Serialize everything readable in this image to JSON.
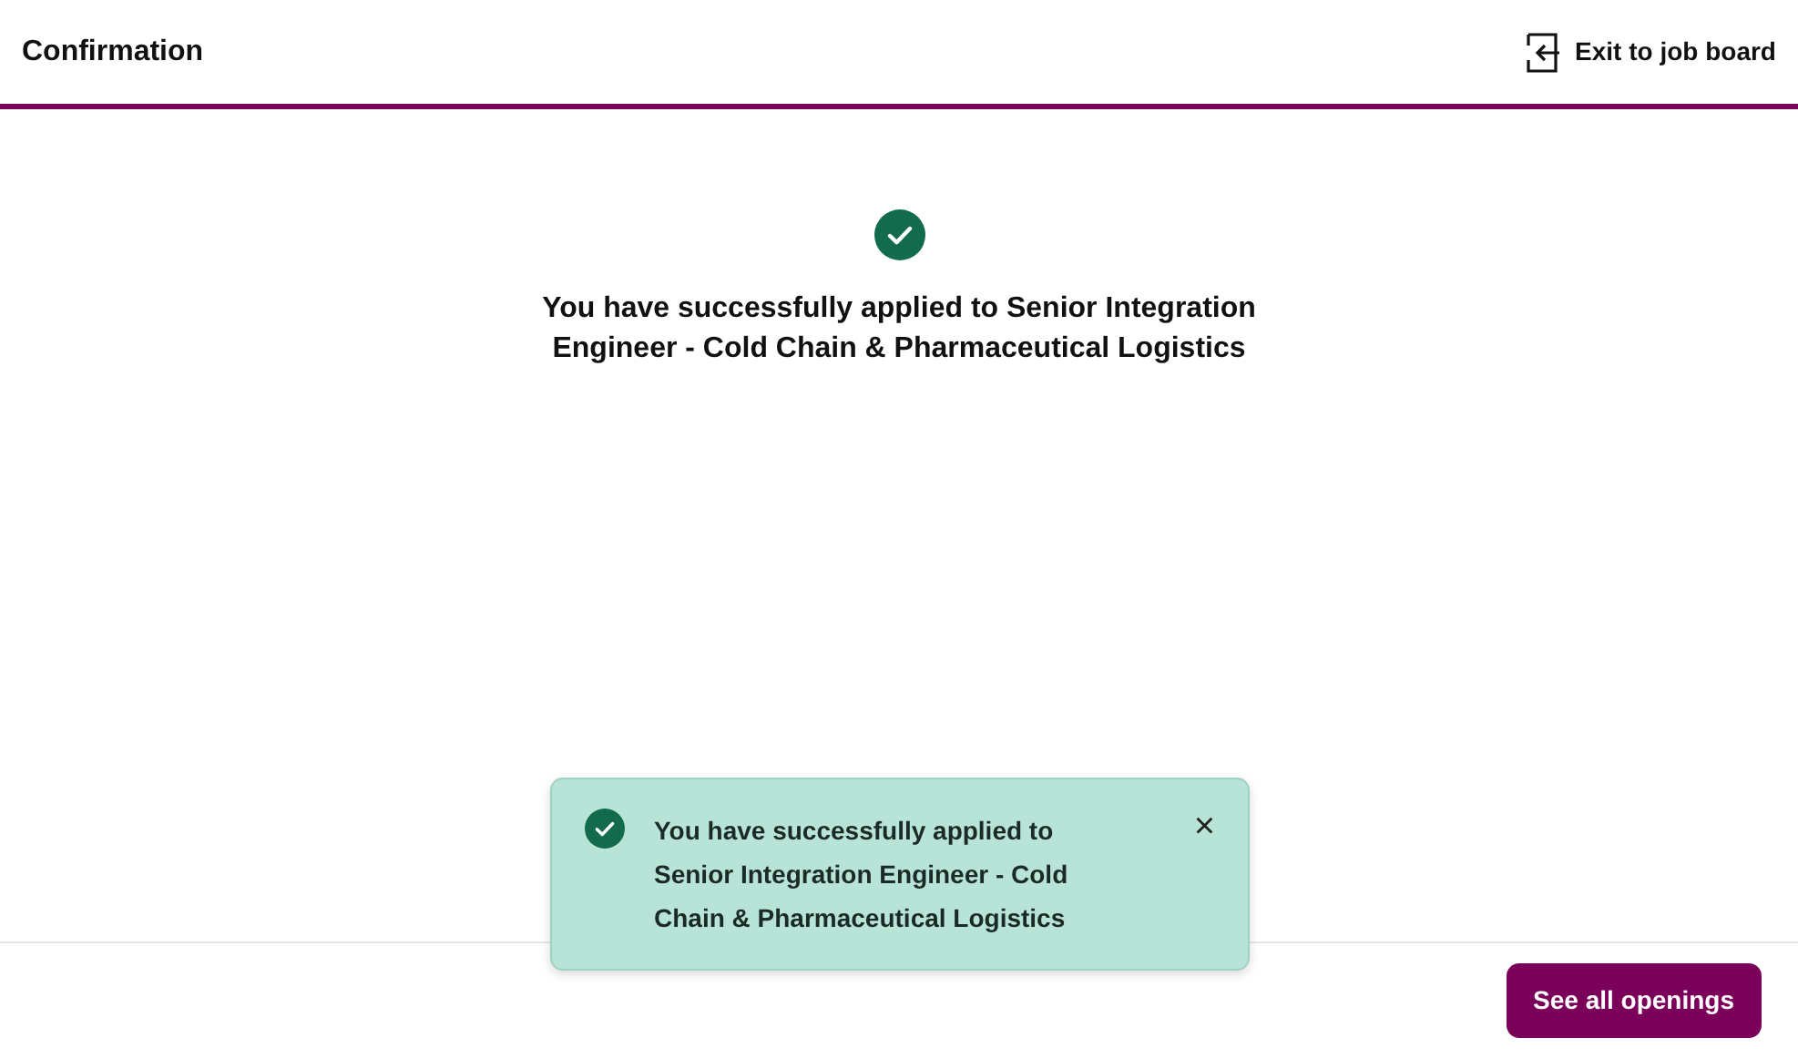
{
  "header": {
    "title": "Confirmation",
    "exit_link": "Exit to job board"
  },
  "confirmation": {
    "message": "You have successfully applied to Senior Integration Engineer - Cold Chain & Pharmaceutical Logistics"
  },
  "toast": {
    "message": "You have successfully applied to Senior Integration Engineer - Cold Chain & Pharmaceutical Logistics",
    "close": "×"
  },
  "footer": {
    "button": "See all openings"
  }
}
